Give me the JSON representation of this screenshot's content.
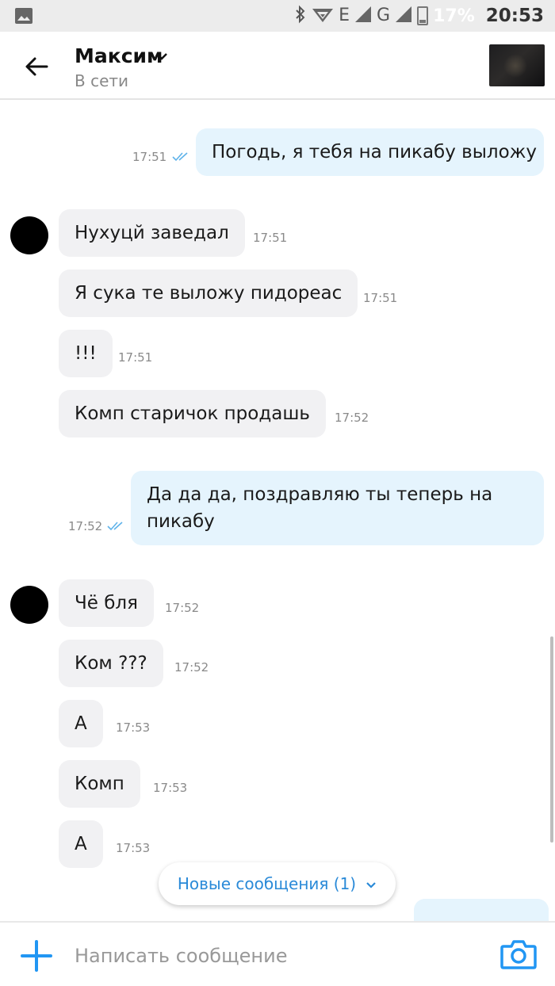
{
  "status_bar": {
    "battery_percent": "17%",
    "time": "20:53",
    "network_e": "E",
    "network_g": "G"
  },
  "header": {
    "contact_name": "Максим",
    "contact_status": "В сети"
  },
  "messages": [
    {
      "direction": "out",
      "text": "Погодь, я тебя на пикабу выложу",
      "time": "17:51",
      "read": true
    },
    {
      "direction": "in",
      "text": "Нухуцй заведал",
      "time": "17:51"
    },
    {
      "direction": "in",
      "text": "Я сука те выложу пидореас",
      "time": "17:51"
    },
    {
      "direction": "in",
      "text": "!!!",
      "time": "17:51"
    },
    {
      "direction": "in",
      "text": "Комп старичок продашь",
      "time": "17:52"
    },
    {
      "direction": "out",
      "text": "Да да да, поздравляю ты теперь на пикабу",
      "time": "17:52",
      "read": true
    },
    {
      "direction": "in",
      "text": "Чё бля",
      "time": "17:52"
    },
    {
      "direction": "in",
      "text": "Ком ???",
      "time": "17:52"
    },
    {
      "direction": "in",
      "text": "А",
      "time": "17:53"
    },
    {
      "direction": "in",
      "text": "Комп",
      "time": "17:53"
    },
    {
      "direction": "in",
      "text": "А",
      "time": "17:53"
    }
  ],
  "new_messages_button": {
    "label": "Новые сообщения (1)"
  },
  "composer": {
    "placeholder": "Написать сообщение"
  },
  "colors": {
    "accent": "#2196f3",
    "incoming_bubble": "#f1f1f3",
    "outgoing_bubble": "#e5f4fd",
    "read_checks": "#5fb3ea"
  }
}
